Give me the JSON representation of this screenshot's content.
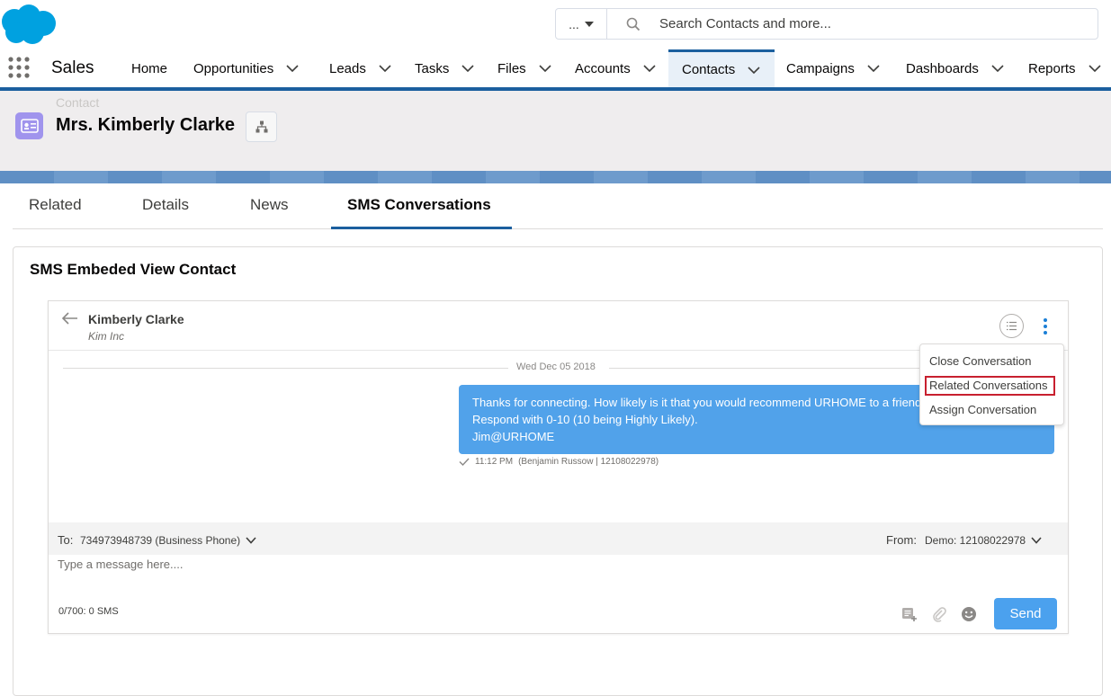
{
  "app": {
    "name": "Sales"
  },
  "search": {
    "scope_label": "...",
    "placeholder": "Search Contacts and more..."
  },
  "nav": {
    "home": "Home",
    "opportunities": "Opportunities",
    "leads": "Leads",
    "tasks": "Tasks",
    "files": "Files",
    "accounts": "Accounts",
    "contacts": "Contacts",
    "campaigns": "Campaigns",
    "dashboards": "Dashboards",
    "reports": "Reports",
    "active": "Contacts"
  },
  "record": {
    "object_label": "Contact",
    "name": "Mrs. Kimberly Clarke"
  },
  "tabs": {
    "related": "Related",
    "details": "Details",
    "news": "News",
    "sms": "SMS Conversations",
    "active": "SMS Conversations"
  },
  "card": {
    "title": "SMS Embeded View Contact"
  },
  "conversation": {
    "contact_name": "Kimberly Clarke",
    "company": "Kim Inc",
    "date": "Wed Dec 05 2018",
    "message": {
      "line1": "Thanks for connecting. How likely is it that you would recommend URHOME to a friend?",
      "line2": "Respond with 0-10 (10 being Highly Likely).",
      "line3": "Jim@URHOME",
      "time": "11:12 PM",
      "sender": "(Benjamin Russow | 12108022978)"
    }
  },
  "menu": {
    "close": "Close Conversation",
    "related": "Related Conversations",
    "assign": "Assign Conversation"
  },
  "composer": {
    "to_label": "To:",
    "to_value": "734973948739 (Business Phone)",
    "from_label": "From:",
    "from_value": "Demo: 12108022978",
    "placeholder": "Type a message here....",
    "char_count": "0/700: 0 SMS",
    "send_label": "Send"
  },
  "colors": {
    "brand": "#1b5f9e",
    "bubble": "#51a2ea",
    "send": "#4ba1ee",
    "highlight": "#c8202f",
    "contact_icon": "#a094ed"
  }
}
